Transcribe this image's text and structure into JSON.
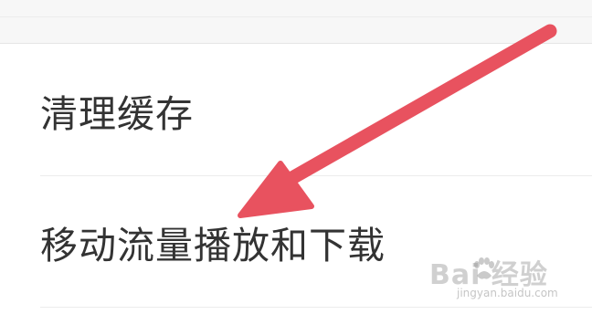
{
  "settings": {
    "items": [
      {
        "label": "清理缓存"
      },
      {
        "label": "移动流量播放和下载"
      }
    ]
  },
  "annotation": {
    "arrow_color": "#e8525f"
  },
  "watermark": {
    "brand": "Bai  经验",
    "url": "jingyan.baidu.com"
  }
}
